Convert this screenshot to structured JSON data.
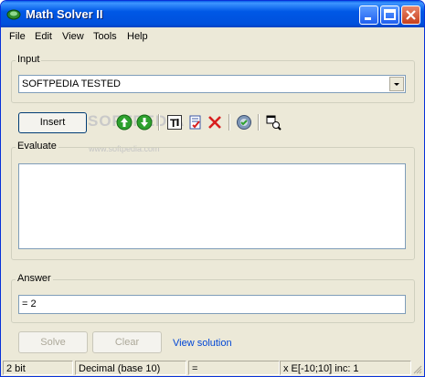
{
  "window": {
    "title": "Math Solver II"
  },
  "menu": [
    "File",
    "Edit",
    "View",
    "Tools",
    "Help"
  ],
  "input_group": {
    "label": "Input",
    "value": "SOFTPEDIA TESTED"
  },
  "toolbar": {
    "insert_label": "Insert"
  },
  "watermark": {
    "big": "SOFTPEDIA",
    "small": "www.softpedia.com"
  },
  "evaluate_group": {
    "label": "Evaluate",
    "value": ""
  },
  "answer_group": {
    "label": "Answer",
    "value": "= 2"
  },
  "actions": {
    "solve_label": "Solve",
    "clear_label": "Clear",
    "view_solution": "View solution"
  },
  "status": [
    "2 bit",
    "Decimal (base 10)",
    "=",
    "x E[-10;10] inc: 1"
  ],
  "colors": {
    "title_blue": "#0058e6",
    "link": "#0046d5",
    "arrow_green": "#2ea12e",
    "delete_red": "#d81e1e"
  }
}
